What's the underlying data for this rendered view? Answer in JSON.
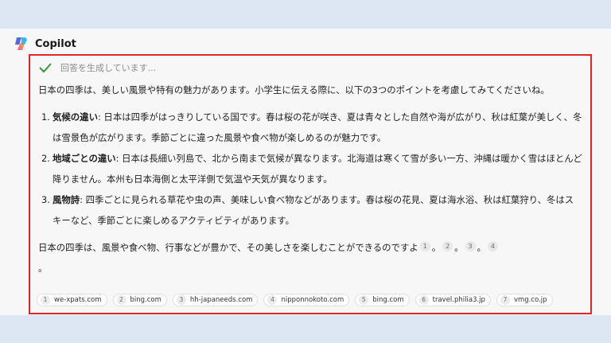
{
  "header": {
    "brand": "Copilot"
  },
  "status": {
    "text": "回答を生成しています..."
  },
  "intro": "日本の四季は、美しい風景や特有の魅力があります。小学生に伝える際に、以下の3つのポイントを考慮してみてくださいね。",
  "points": [
    {
      "num": "1.",
      "term": "気候の違い",
      "text": ": 日本は四季がはっきりしている国です。春は桜の花が咲き、夏は青々とした自然や海が広がり、秋は紅葉が美しく、冬は雪景色が広がります。季節ごとに違った風景や食べ物が楽しめるのが魅力です。"
    },
    {
      "num": "2.",
      "term": "地域ごとの違い",
      "text": ": 日本は長細い列島で、北から南まで気候が異なります。北海道は寒くて雪が多い一方、沖縄は暖かく雪はほとんど降りません。本州も日本海側と太平洋側で気温や天気が異なります。"
    },
    {
      "num": "3.",
      "term": "風物詩",
      "text": ": 四季ごとに見られる草花や虫の声、美味しい食べ物などがあります。春は桜の花見、夏は海水浴、秋は紅葉狩り、冬はスキーなど、季節ごとに楽しめるアクティビティがあります。"
    }
  ],
  "closing": {
    "text": "日本の四季は、風景や食べ物、行事などが豊かで、その美しさを楽しむことができるのですよ",
    "cites": [
      "1",
      "2",
      "3",
      "4"
    ],
    "sep": "。"
  },
  "sources": [
    {
      "idx": "1",
      "label": "we-xpats.com"
    },
    {
      "idx": "2",
      "label": "bing.com"
    },
    {
      "idx": "3",
      "label": "hh-japaneeds.com"
    },
    {
      "idx": "4",
      "label": "nipponnokoto.com"
    },
    {
      "idx": "5",
      "label": "bing.com"
    },
    {
      "idx": "6",
      "label": "travel.philia3.jp"
    },
    {
      "idx": "7",
      "label": "vmg.co.jp"
    }
  ],
  "colors": {
    "accent_border": "#e0262b",
    "check": "#2e9b3a"
  }
}
